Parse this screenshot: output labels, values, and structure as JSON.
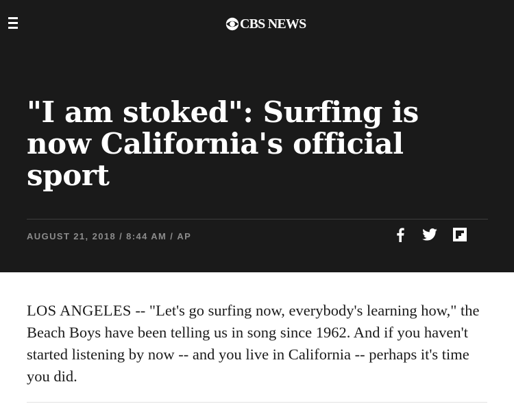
{
  "header": {
    "menu_icon": "hamburger-menu-icon",
    "logo_icon": "cbs-eye-icon",
    "logo_text": "CBS NEWS"
  },
  "article": {
    "headline": "\"I am stoked\": Surfing is now California's official sport",
    "meta": {
      "date": "AUGUST 21, 2018",
      "time": "8:44 AM",
      "source": "AP",
      "separator": "/"
    },
    "share_icons": [
      "facebook-icon",
      "twitter-icon",
      "flipboard-icon"
    ],
    "dateline": "LOS ANGELES",
    "lead": " -- \"Let's go surfing now, everybody's learning how,\" the Beach Boys have been telling us in song since 1962. And if you haven't started listening by now -- and you live in California -- perhaps it's time you did."
  },
  "colors": {
    "header_background": "#1a1a1a",
    "text_on_dark": "#ffffff",
    "meta_text": "#8c8c8c",
    "body_text": "#1a1a1a"
  }
}
